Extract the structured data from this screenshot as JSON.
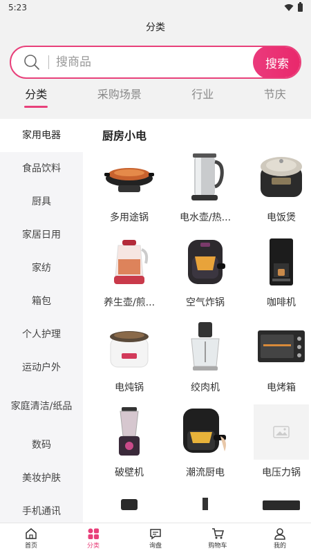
{
  "status": {
    "time": "5:23"
  },
  "header": {
    "title": "分类"
  },
  "search": {
    "placeholder": "搜商品",
    "button_label": "搜索"
  },
  "tabs": [
    {
      "label": "分类",
      "active": true
    },
    {
      "label": "采购场景",
      "active": false
    },
    {
      "label": "行业",
      "active": false
    },
    {
      "label": "节庆",
      "active": false
    }
  ],
  "sidebar": {
    "items": [
      {
        "label": "家用电器",
        "active": true
      },
      {
        "label": "食品饮料"
      },
      {
        "label": "厨具"
      },
      {
        "label": "家居日用"
      },
      {
        "label": "家纺"
      },
      {
        "label": "箱包"
      },
      {
        "label": "个人护理"
      },
      {
        "label": "运动户外"
      },
      {
        "label": "家庭清洁/纸品"
      },
      {
        "label": "数码"
      },
      {
        "label": "美妆护肤"
      },
      {
        "label": "手机通讯"
      }
    ]
  },
  "main": {
    "section_title": "厨房小电",
    "products": [
      {
        "label": "多用途锅",
        "icon": "hot-pot"
      },
      {
        "label": "电水壶/热...",
        "icon": "kettle"
      },
      {
        "label": "电饭煲",
        "icon": "rice-cooker"
      },
      {
        "label": "养生壶/煎...",
        "icon": "health-pot"
      },
      {
        "label": "空气炸锅",
        "icon": "air-fryer"
      },
      {
        "label": "咖啡机",
        "icon": "coffee-machine"
      },
      {
        "label": "电炖锅",
        "icon": "stew-pot"
      },
      {
        "label": "绞肉机",
        "icon": "meat-grinder"
      },
      {
        "label": "电烤箱",
        "icon": "oven"
      },
      {
        "label": "破壁机",
        "icon": "blender"
      },
      {
        "label": "潮流厨电",
        "icon": "fryer"
      },
      {
        "label": "电压力锅",
        "icon": "image-placeholder"
      }
    ]
  },
  "bottom_nav": [
    {
      "label": "首页",
      "icon": "home-icon"
    },
    {
      "label": "分类",
      "icon": "category-icon",
      "active": true
    },
    {
      "label": "询盘",
      "icon": "inquiry-icon"
    },
    {
      "label": "购物车",
      "icon": "cart-icon"
    },
    {
      "label": "我的",
      "icon": "profile-icon"
    }
  ],
  "colors": {
    "accent": "#e8407a",
    "background": "#f2f2f2"
  }
}
